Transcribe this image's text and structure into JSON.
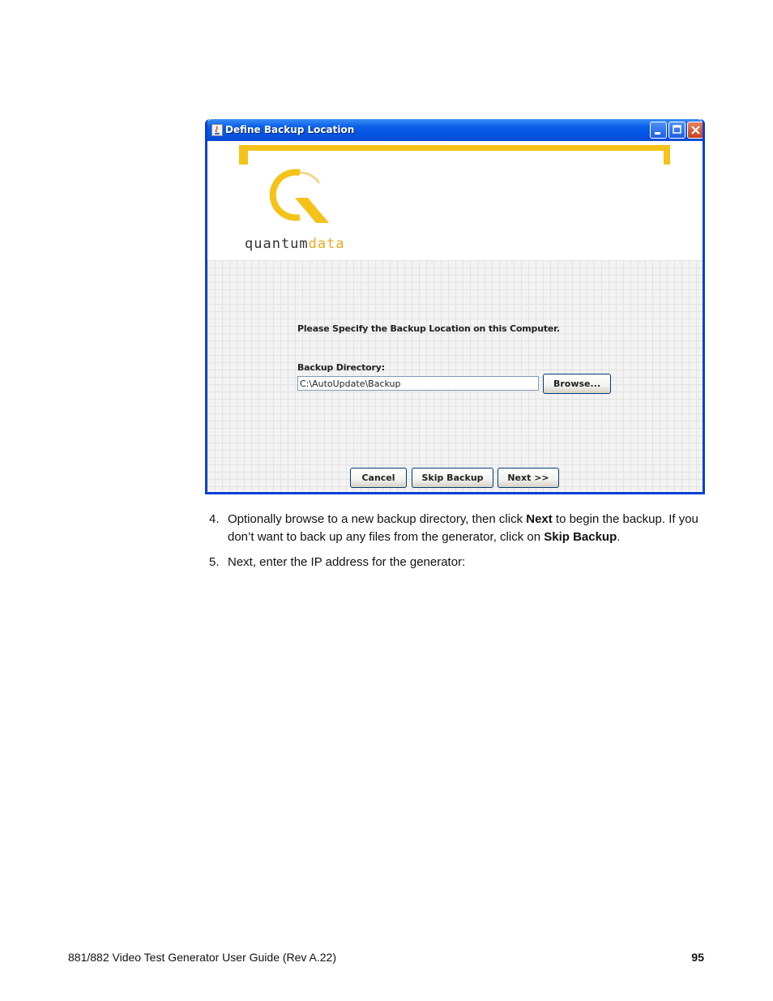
{
  "window": {
    "title": "Define Backup Location",
    "brand_left": "quantum",
    "brand_right": "data",
    "prompt": "Please Specify the Backup Location on this Computer.",
    "directory_label": "Backup Directory:",
    "directory_value": "C:\\AutoUpdate\\Backup",
    "buttons": {
      "browse": "Browse...",
      "cancel": "Cancel",
      "skip": "Skip Backup",
      "next": "Next >>"
    },
    "colors": {
      "titlebar": "#0554e3",
      "accent": "#f5c21a",
      "close": "#c8401d"
    }
  },
  "steps": [
    {
      "num": "4.",
      "t1": "Optionally browse to a new backup directory, then click ",
      "b1": "Next",
      "t2": " to begin the backup. If you don’t want to back up any files from the generator, click on ",
      "b2": "Skip Backup",
      "t3": "."
    },
    {
      "num": "5.",
      "text": "Next, enter the IP address for the generator:"
    }
  ],
  "footer": {
    "title": "881/882 Video Test Generator User Guide (Rev A.22)",
    "page": "95"
  }
}
